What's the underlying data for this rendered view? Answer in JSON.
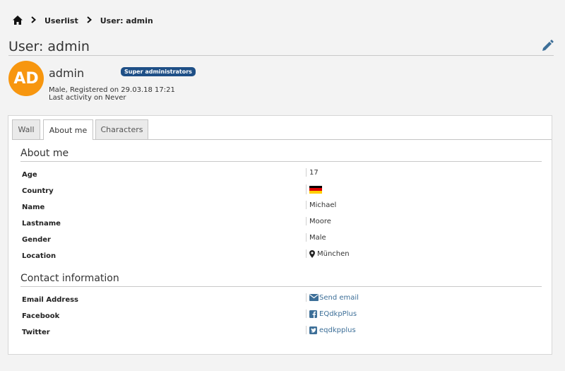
{
  "breadcrumb": {
    "items": [
      "Userlist",
      "User: admin"
    ]
  },
  "header": {
    "title": "User: admin"
  },
  "profile": {
    "avatar_initials": "AD",
    "avatar_color": "#f7960f",
    "name": "admin",
    "badge": "Super administrators",
    "badge_color": "#1e4f86",
    "registered": "Male, Registered on 29.03.18 17:21",
    "last_activity": "Last activity on Never"
  },
  "tabs": [
    {
      "label": "Wall",
      "active": false
    },
    {
      "label": "About me",
      "active": true
    },
    {
      "label": "Characters",
      "active": false
    }
  ],
  "about": {
    "title": "About me",
    "rows": [
      {
        "label": "Age",
        "value": "17"
      },
      {
        "label": "Country",
        "value": "",
        "icon": "germany-flag-icon"
      },
      {
        "label": "Name",
        "value": "Michael"
      },
      {
        "label": "Lastname",
        "value": "Moore"
      },
      {
        "label": "Gender",
        "value": "Male"
      },
      {
        "label": "Location",
        "value": "München",
        "icon": "map-marker-icon"
      }
    ]
  },
  "contact": {
    "title": "Contact information",
    "rows": [
      {
        "label": "Email Address",
        "value": "Send email",
        "icon": "envelope-icon"
      },
      {
        "label": "Facebook",
        "value": "EQdkpPlus",
        "icon": "facebook-icon"
      },
      {
        "label": "Twitter",
        "value": "eqdkpplus",
        "icon": "twitter-icon"
      }
    ]
  },
  "colors": {
    "link": "#3d6f98",
    "background": "#f3f3f3"
  }
}
